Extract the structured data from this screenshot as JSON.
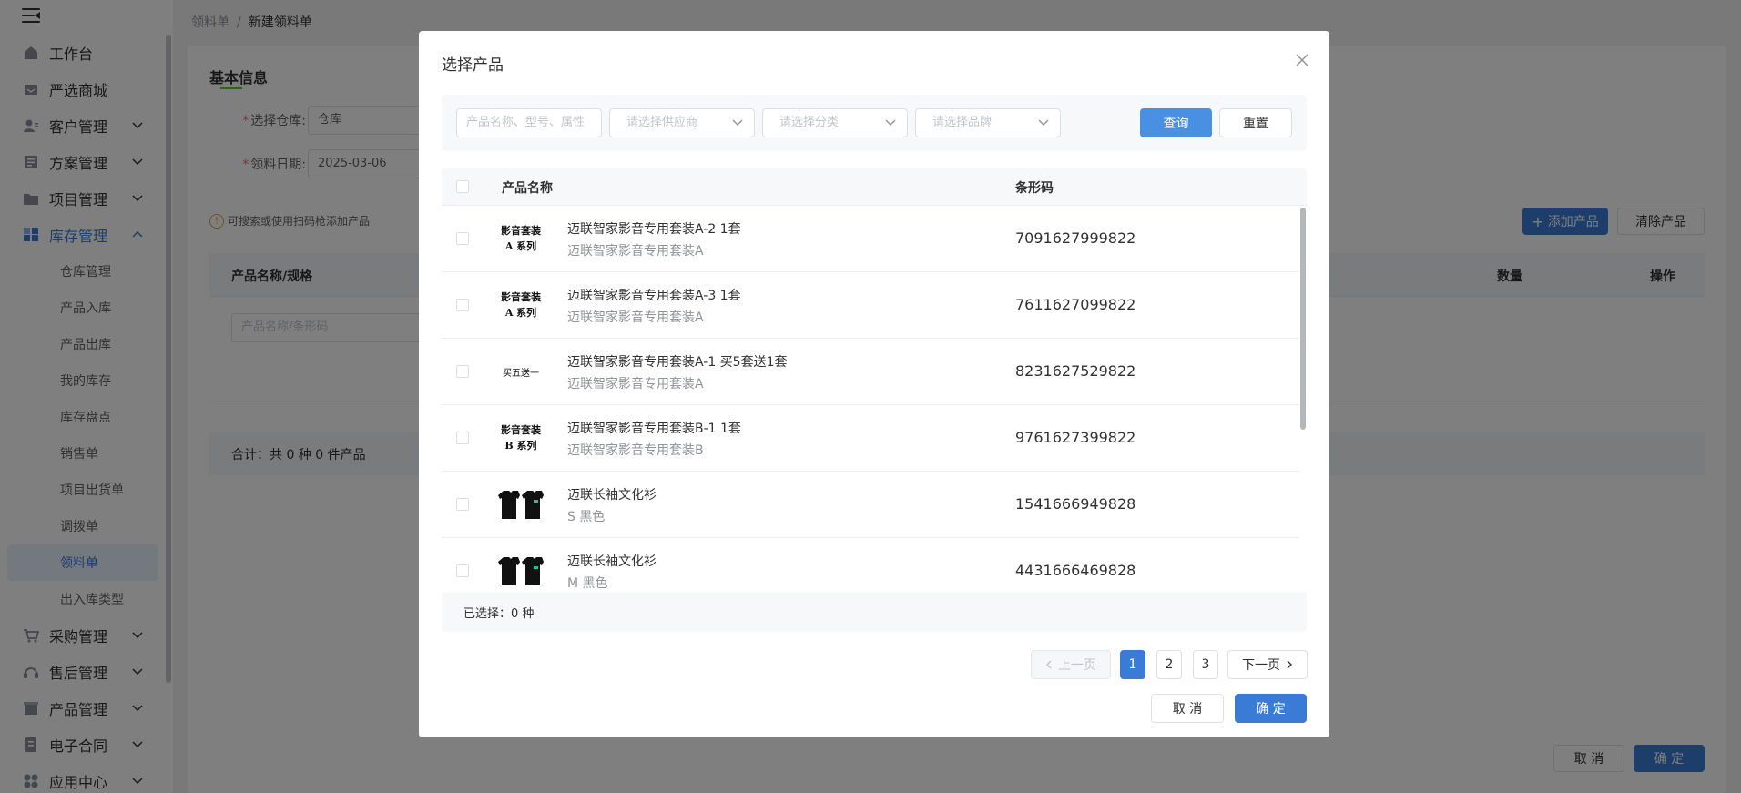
{
  "sidebar": {
    "items": [
      {
        "label": "工作台",
        "icon": "home-icon"
      },
      {
        "label": "严选商城",
        "icon": "store-icon"
      },
      {
        "label": "客户管理",
        "icon": "user-icon"
      },
      {
        "label": "方案管理",
        "icon": "document-icon"
      },
      {
        "label": "项目管理",
        "icon": "folder-icon"
      },
      {
        "label": "库存管理",
        "icon": "grid-icon"
      }
    ],
    "sub_items": [
      "仓库管理",
      "产品入库",
      "产品出库",
      "我的库存",
      "库存盘点",
      "销售单",
      "项目出货单",
      "调拨单",
      "领料单",
      "出入库类型"
    ],
    "bottom_items": [
      {
        "label": "采购管理",
        "icon": "cart-icon"
      },
      {
        "label": "售后管理",
        "icon": "headset-icon"
      },
      {
        "label": "产品管理",
        "icon": "box-icon"
      },
      {
        "label": "电子合同",
        "icon": "contract-icon"
      },
      {
        "label": "应用中心",
        "icon": "apps-icon"
      }
    ]
  },
  "breadcrumb": {
    "parent": "领料单",
    "separator": "/",
    "current": "新建领料单"
  },
  "page": {
    "section_title": "基本信息",
    "warehouse_label": "选择仓库:",
    "warehouse_value": "仓库",
    "date_label": "领料日期:",
    "date_value": "2025-03-06",
    "tip": "可搜索或使用扫码枪添加产品",
    "add_product": "添加产品",
    "clear_product": "清除产品",
    "table_headers": {
      "name": "产品名称/规格",
      "qty": "数量",
      "action": "操作"
    },
    "search_placeholder": "产品名称/条形码",
    "summary": "合计：共 0 种 0 件产品",
    "cancel": "取 消",
    "confirm": "确 定"
  },
  "dialog": {
    "title": "选择产品",
    "filters": {
      "keyword_placeholder": "产品名称、型号、属性",
      "supplier_placeholder": "请选择供应商",
      "category_placeholder": "请选择分类",
      "brand_placeholder": "请选择品牌",
      "search": "查询",
      "reset": "重置"
    },
    "headers": {
      "name": "产品名称",
      "barcode": "条形码"
    },
    "rows": [
      {
        "name": "迈联智家影音专用套装A-2 1套",
        "spec": "迈联智家影音专用套装A",
        "barcode": "7091627999822",
        "thumb_line1": "影音套装",
        "thumb_line2": "A 系列"
      },
      {
        "name": "迈联智家影音专用套装A-3 1套",
        "spec": "迈联智家影音专用套装A",
        "barcode": "7611627099822",
        "thumb_line1": "影音套装",
        "thumb_line2": "A 系列"
      },
      {
        "name": "迈联智家影音专用套装A-1 买5套送1套",
        "spec": "迈联智家影音专用套装A",
        "barcode": "8231627529822",
        "thumb_line1": "买五送一",
        "thumb_line2": ""
      },
      {
        "name": "迈联智家影音专用套装B-1 1套",
        "spec": "迈联智家影音专用套装B",
        "barcode": "9761627399822",
        "thumb_line1": "影音套装",
        "thumb_line2": "B 系列"
      },
      {
        "name": "迈联长袖文化衫",
        "spec": "S 黑色",
        "barcode": "1541666949828",
        "thumb_line1": "",
        "thumb_line2": ""
      },
      {
        "name": "迈联长袖文化衫",
        "spec": "M 黑色",
        "barcode": "4431666469828",
        "thumb_line1": "",
        "thumb_line2": ""
      }
    ],
    "selected": "已选择：0 种",
    "pagination": {
      "prev": "上一页",
      "pages": [
        "1",
        "2",
        "3"
      ],
      "current": "1",
      "next": "下一页"
    },
    "cancel": "取 消",
    "confirm": "确 定"
  },
  "colors": {
    "primary": "#3a7bd5",
    "required": "#f56c6c",
    "warning": "#e6a23c"
  }
}
